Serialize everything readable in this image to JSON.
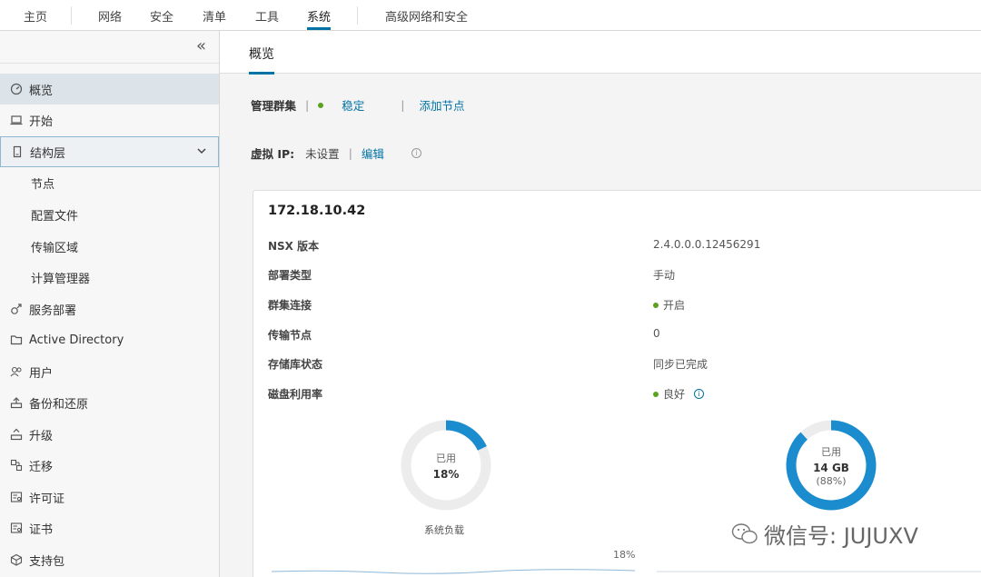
{
  "topnav": {
    "tabs": [
      "主页",
      "网络",
      "安全",
      "清单",
      "工具",
      "系统",
      "高级网络和安全"
    ],
    "active": "系统"
  },
  "sidebar": {
    "collapse_icon": "chevron-double-left-icon",
    "items": [
      {
        "label": "概览",
        "icon": "dashboard-icon"
      },
      {
        "label": "开始",
        "icon": "laptop-icon"
      },
      {
        "label": "结构层",
        "icon": "device-icon"
      },
      {
        "label": "节点"
      },
      {
        "label": "配置文件"
      },
      {
        "label": "传输区域"
      },
      {
        "label": "计算管理器"
      },
      {
        "label": "服务部署",
        "icon": "service-icon"
      },
      {
        "label": "Active Directory",
        "icon": "folder-icon"
      },
      {
        "label": "用户",
        "icon": "users-icon"
      },
      {
        "label": "备份和还原",
        "icon": "backup-icon"
      },
      {
        "label": "升级",
        "icon": "upgrade-icon"
      },
      {
        "label": "迁移",
        "icon": "migrate-icon"
      },
      {
        "label": "许可证",
        "icon": "license-icon"
      },
      {
        "label": "证书",
        "icon": "certificate-icon"
      },
      {
        "label": "支持包",
        "icon": "package-icon"
      }
    ]
  },
  "main": {
    "subtab": "概览",
    "cluster": {
      "label": "管理群集",
      "status": "稳定",
      "add_node": "添加节点"
    },
    "vip": {
      "label": "虚拟 IP:",
      "value": "未设置",
      "edit": "编辑"
    },
    "card": {
      "title": "172.18.10.42",
      "properties": [
        {
          "label": "NSX 版本",
          "value": "2.4.0.0.0.12456291"
        },
        {
          "label": "部署类型",
          "value": "手动"
        },
        {
          "label": "群集连接",
          "value": "开启"
        },
        {
          "label": "传输节点",
          "value": "0"
        },
        {
          "label": "存储库状态",
          "value": "同步已完成"
        },
        {
          "label": "磁盘利用率",
          "value": "良好"
        }
      ],
      "donut1": {
        "caption": "已用",
        "value": "18%",
        "percent": 18,
        "label": "系统负载"
      },
      "donut2": {
        "caption": "已用",
        "value": "14 GB",
        "sub": "(88%)",
        "percent": 88
      },
      "spark_label": "18%"
    }
  },
  "colors": {
    "accent": "#0072a3",
    "ok": "#5aa220",
    "donut": "#1b8dce",
    "track": "#ececec"
  },
  "watermark": "微信号: JUJUXV"
}
